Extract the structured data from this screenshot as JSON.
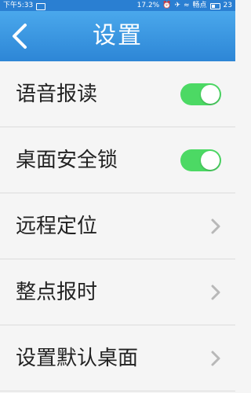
{
  "status_bar": {
    "time": "下午5:33",
    "battery_percent": "17.2%",
    "carrier": "畅点",
    "clock_right": "23",
    "icons": [
      "message-icon",
      "alarm-icon",
      "airplane-icon",
      "signal-icon",
      "battery-icon"
    ]
  },
  "header": {
    "title": "设置",
    "back_icon": "back-chevron-icon",
    "colors": {
      "bar_top": "#4aa8ec",
      "bar_bottom": "#2d86d6"
    }
  },
  "settings": {
    "items": [
      {
        "label": "语音报读",
        "control": "toggle",
        "enabled": true
      },
      {
        "label": "桌面安全锁",
        "control": "toggle",
        "enabled": true
      },
      {
        "label": "远程定位",
        "control": "chevron"
      },
      {
        "label": "整点报时",
        "control": "chevron"
      },
      {
        "label": "设置默认桌面",
        "control": "chevron"
      }
    ],
    "toggle_on_color": "#4cd964"
  }
}
